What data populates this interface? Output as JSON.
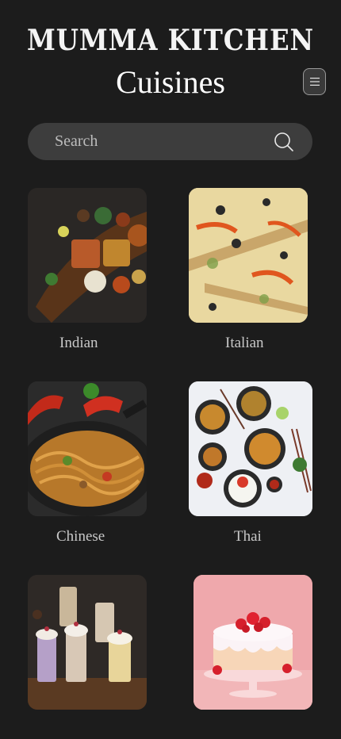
{
  "header": {
    "brand": "MUMMA KITCHEN",
    "title": "Cuisines",
    "menu_icon": "hamburger-menu-icon"
  },
  "search": {
    "placeholder": "Search",
    "icon": "search-icon"
  },
  "cuisines": [
    {
      "label": "Indian"
    },
    {
      "label": "Italian"
    },
    {
      "label": "Chinese"
    },
    {
      "label": "Thai"
    },
    {
      "label": ""
    },
    {
      "label": ""
    }
  ],
  "colors": {
    "background": "#1c1c1c",
    "search_bg": "#3d3d3d",
    "text": "#ffffff",
    "label": "#c8c8c8"
  }
}
